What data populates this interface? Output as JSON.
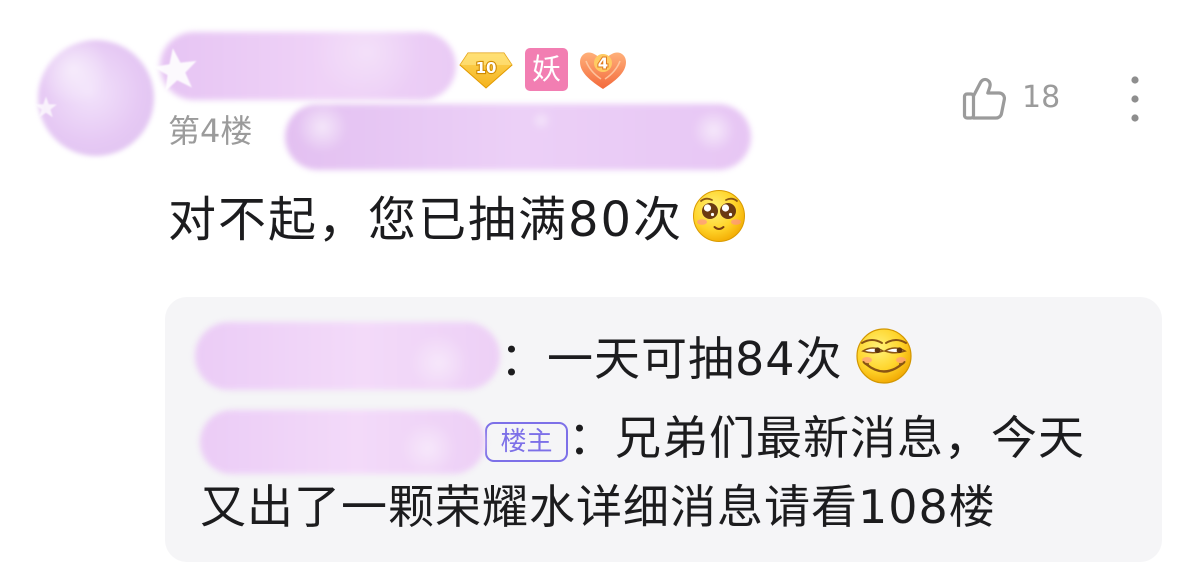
{
  "colors": {
    "background": "#ffffff",
    "text_primary": "#1c1c1e",
    "text_secondary": "#9b9b9b",
    "reply_panel": "#f5f5f7",
    "op_badge": "#7d70e8",
    "level_badge": "#f4b21e",
    "title_badge": "#f27eb2",
    "fan_badge": "#f36a3c"
  },
  "post": {
    "badges": [
      {
        "icon": "level-diamond-icon",
        "text": "10"
      },
      {
        "icon": "title-badge-icon",
        "text": "妖"
      },
      {
        "icon": "fan-level-heart-icon",
        "text": "4"
      }
    ],
    "floor_label": "第4楼",
    "like_icon": "thumbs-up-icon",
    "like_count": "18",
    "more_icon": "more-vertical-icon",
    "content": "对不起，您已抽满80次",
    "content_emoji": "pleading-face-emoji-icon"
  },
  "replies": [
    {
      "separator": "：",
      "text_lines": [
        "一天可抽84次"
      ],
      "emoji": "smug-face-emoji-icon"
    },
    {
      "author_badge": "楼主",
      "separator": "：",
      "text_lines": [
        "兄弟们最新消息，今天",
        "又出了一颗荣耀水详细消息请看108楼"
      ]
    }
  ]
}
